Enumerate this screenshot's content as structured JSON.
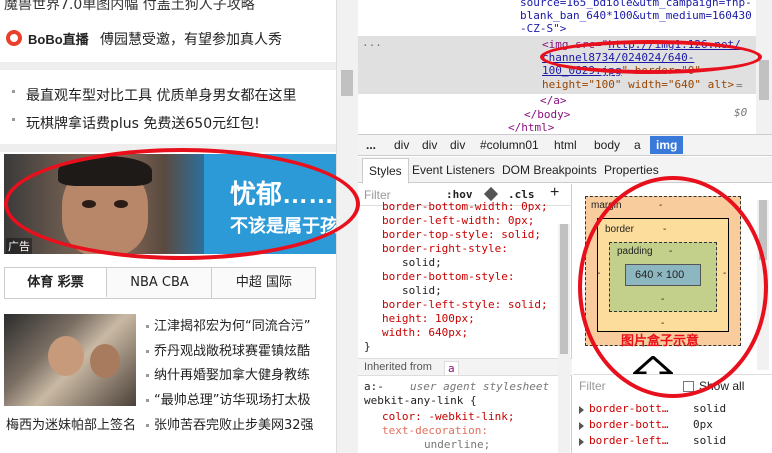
{
  "left": {
    "top_line": "魔兽世界7.0单图内幅 付盖土狗人子攻略",
    "bobo_brand": "BoBo直播",
    "bobo_text": "傅园慧受邀，有望参加真人秀",
    "promo_lines": [
      "最直观车型对比工具 优质单身男女都在这里",
      "玩棋牌拿话费plus 免费送650元红包!"
    ],
    "banner": {
      "headline": "忧郁……",
      "subline": "不该是属于孩",
      "ad_label": "广告"
    },
    "tabs": [
      "体育 彩票",
      "NBA CBA",
      "中超 国际"
    ],
    "headlines": [
      "江津揭祁宏为何“同流合污”",
      "乔丹观战敞税球赛霍镇炫酷",
      "纳什再婚娶加拿大健身教练",
      "“最帅总理”访华现场打太极",
      "张帅苦吞完败止步美网32强"
    ],
    "caption_left": "梅西为迷妹帕部上签名"
  },
  "devtools": {
    "code": {
      "l1": "source=165_bdiole&utm_campaign=fnp-",
      "l2": "blank_ban_640*100&utm_medium=160430",
      "l3": "-CZ-S\">",
      "dots": "...",
      "img_tag": "<img src=\"",
      "img_url1": "http://img1.126.net/",
      "img_url2": "channel8734/024024/640-",
      "img_url3": "100_0829.jpg",
      "img_rest3": "\" border=\"0\"",
      "h_attr": "height=\"100\"",
      "w_attr": "width=\"640\"",
      "alt_attr": "alt>",
      "eq": "=",
      "dollar0": "$0",
      "close_a": "</a>",
      "close_body": "</body>",
      "close_html": "</html>"
    },
    "breadcrumb": [
      "...",
      "div",
      "div",
      "div",
      "#column01",
      "html",
      "body",
      "a",
      "img"
    ],
    "pane_tabs": [
      "Styles",
      "Event Listeners",
      "DOM Breakpoints",
      "Properties"
    ],
    "filter": {
      "placeholder": "Filter",
      "hov": ":hov",
      "cls": ".cls",
      "plus": "+"
    },
    "styles_lines": [
      "border-bottom-width: 0px;",
      "border-left-width: 0px;",
      "border-top-style: solid;",
      "border-right-style:",
      "solid;",
      "border-bottom-style:",
      "solid;",
      "border-left-style: solid;",
      "height: 100px;",
      "width: 640px;",
      "}"
    ],
    "inherited_label": "Inherited from",
    "inherited_tag": "a",
    "ua_selector": "a:-",
    "ua_label": "user agent stylesheet",
    "ua_selector2": "webkit-any-link {",
    "ua_lines": [
      "color: -webkit-link;",
      "text-decoration:",
      "underline;"
    ],
    "boxmodel": {
      "margin": "margin",
      "border": "border",
      "padding": "padding",
      "dash": "-",
      "content": "640 × 100",
      "note": "图片盒子示意"
    },
    "computed": {
      "filter_placeholder": "Filter",
      "show_all": "Show all",
      "rows": [
        {
          "prop": "border-bott…",
          "val": "solid"
        },
        {
          "prop": "border-bott…",
          "val": "0px"
        },
        {
          "prop": "border-left…",
          "val": "solid"
        }
      ]
    }
  }
}
